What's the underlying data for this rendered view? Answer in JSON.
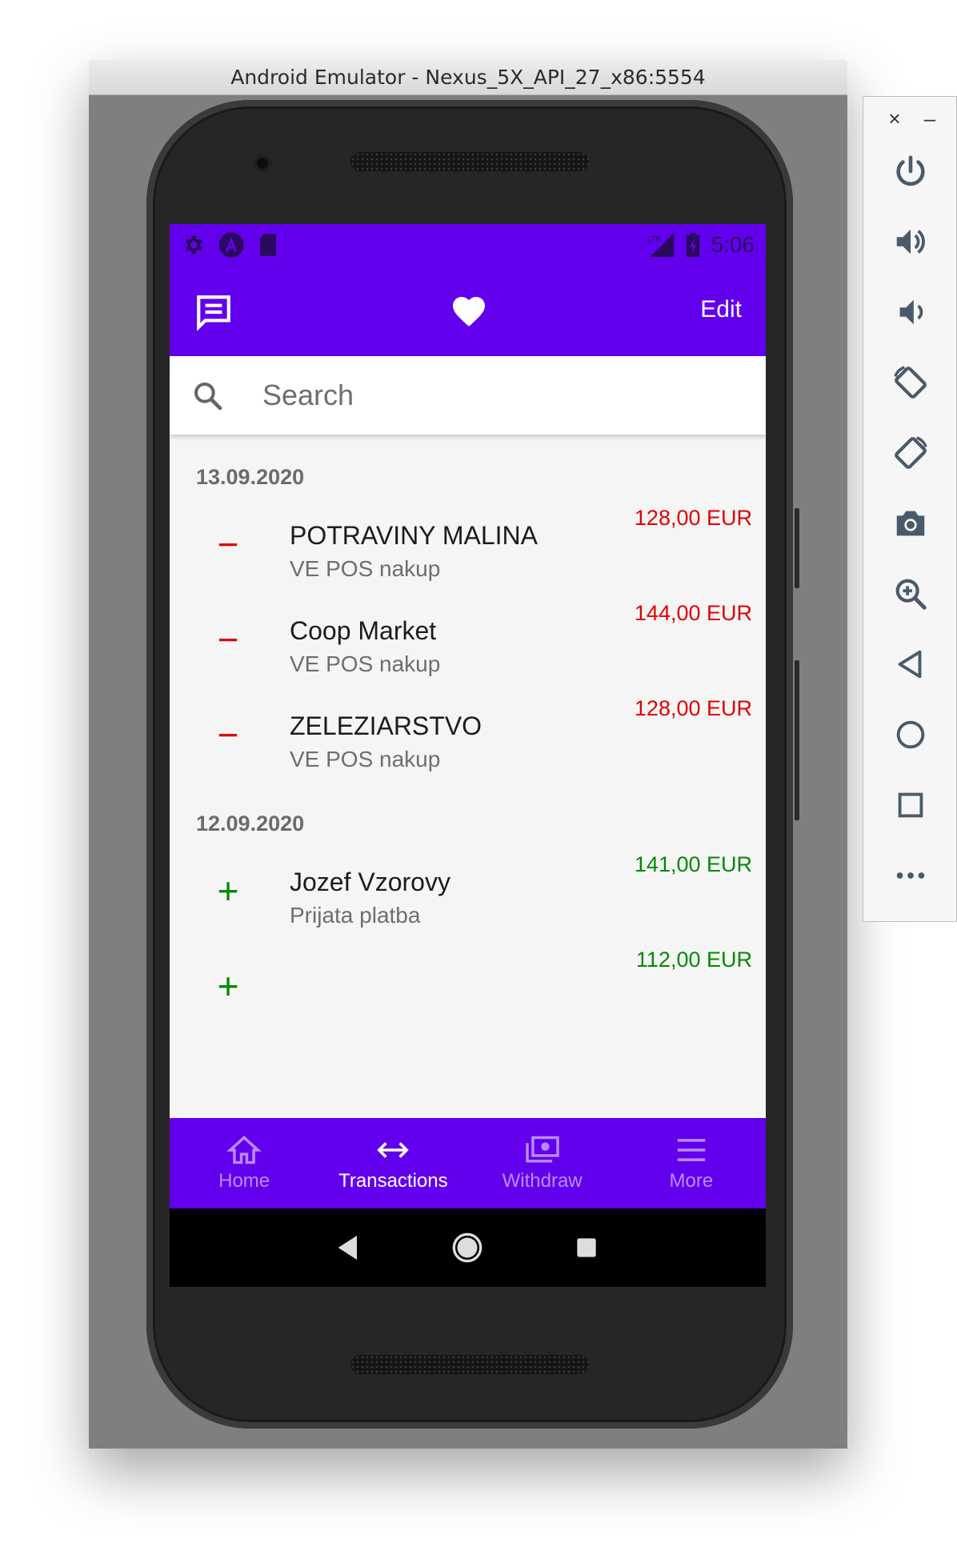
{
  "window": {
    "title": "Android Emulator - Nexus_5X_API_27_x86:5554"
  },
  "status_bar": {
    "time": "5:06",
    "network": "LTE"
  },
  "app_bar": {
    "edit_label": "Edit"
  },
  "search": {
    "placeholder": "Search",
    "value": ""
  },
  "transactions": {
    "groups": [
      {
        "date": "13.09.2020",
        "items": [
          {
            "name": "POTRAVINY MALINA",
            "description": "VE POS nakup",
            "amount": "128,00 EUR",
            "type": "debit"
          },
          {
            "name": "Coop Market",
            "description": "VE POS nakup",
            "amount": "144,00 EUR",
            "type": "debit"
          },
          {
            "name": "ZELEZIARSTVO",
            "description": "VE POS nakup",
            "amount": "128,00 EUR",
            "type": "debit"
          }
        ]
      },
      {
        "date": "12.09.2020",
        "items": [
          {
            "name": "Jozef Vzorovy",
            "description": "Prijata platba",
            "amount": "141,00 EUR",
            "type": "credit"
          },
          {
            "name": "",
            "description": "",
            "amount": "112,00 EUR",
            "type": "credit"
          }
        ]
      }
    ]
  },
  "bottom_nav": {
    "items": [
      {
        "label": "Home",
        "icon": "home-icon",
        "active": false
      },
      {
        "label": "Transactions",
        "icon": "swap-arrows-icon",
        "active": true
      },
      {
        "label": "Withdraw",
        "icon": "cash-icon",
        "active": false
      },
      {
        "label": "More",
        "icon": "menu-icon",
        "active": false
      }
    ]
  },
  "colors": {
    "primary": "#6200ee",
    "debit": "#e00000",
    "credit": "#008a00",
    "inactive_nav": "#b98cff"
  },
  "side_toolbar": {
    "buttons": [
      "power-icon",
      "volume-up-icon",
      "volume-down-icon",
      "rotate-left-icon",
      "rotate-right-icon",
      "camera-icon",
      "zoom-icon",
      "back-icon",
      "home-circle-icon",
      "overview-icon",
      "more-icon"
    ]
  }
}
